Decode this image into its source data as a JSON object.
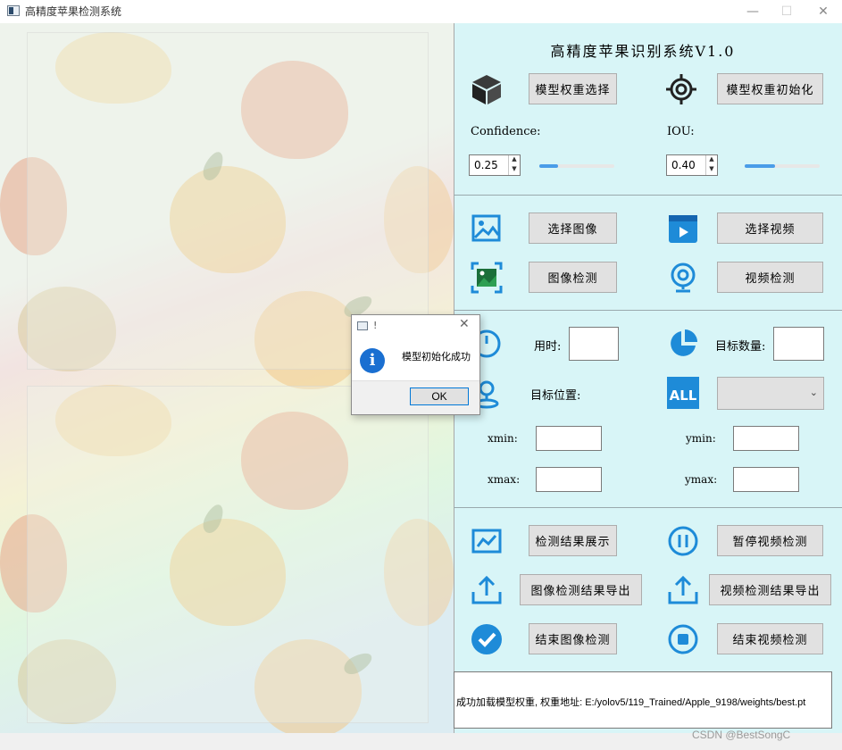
{
  "window": {
    "title": "高精度苹果检测系统",
    "minimize_glyph": "—",
    "maximize_glyph": "☐",
    "close_glyph": "✕"
  },
  "panel": {
    "title": "高精度苹果识别系统V1.0"
  },
  "model": {
    "select_weights_label": "模型权重选择",
    "init_weights_label": "模型权重初始化"
  },
  "params": {
    "confidence_label": "Confidence:",
    "confidence_value": "0.25",
    "confidence_slider_fraction": 0.25,
    "iou_label": "IOU:",
    "iou_value": "0.40",
    "iou_slider_fraction": 0.4
  },
  "media": {
    "select_image_label": "选择图像",
    "select_video_label": "选择视频",
    "image_detect_label": "图像检测",
    "video_detect_label": "视频检测"
  },
  "results": {
    "time_label": "用时:",
    "time_value": "",
    "target_count_label": "目标数量:",
    "target_count_value": "",
    "target_position_label": "目标位置:",
    "target_select_value": "",
    "xmin_label": "xmin:",
    "ymin_label": "ymin:",
    "xmax_label": "xmax:",
    "ymax_label": "ymax:",
    "xmin_value": "",
    "ymin_value": "",
    "xmax_value": "",
    "ymax_value": ""
  },
  "actions": {
    "show_results_label": "检测结果展示",
    "pause_video_label": "暂停视频检测",
    "export_image_label": "图像检测结果导出",
    "export_video_label": "视频检测结果导出",
    "end_image_label": "结束图像检测",
    "end_video_label": "结束视频检测"
  },
  "status": {
    "text": "成功加载模型权重, 权重地址: E:/yolov5/119_Trained/Apple_9198/weights/best.pt"
  },
  "dialog": {
    "title": "!",
    "message": "模型初始化成功",
    "ok_label": "OK",
    "close_glyph": "✕",
    "info_glyph": "i"
  },
  "watermark": "CSDN @BestSongC",
  "colors": {
    "panel_bg": "#d8f5f7",
    "icon_blue": "#1e8bd8",
    "slider_fill": "#4a9ce8"
  }
}
